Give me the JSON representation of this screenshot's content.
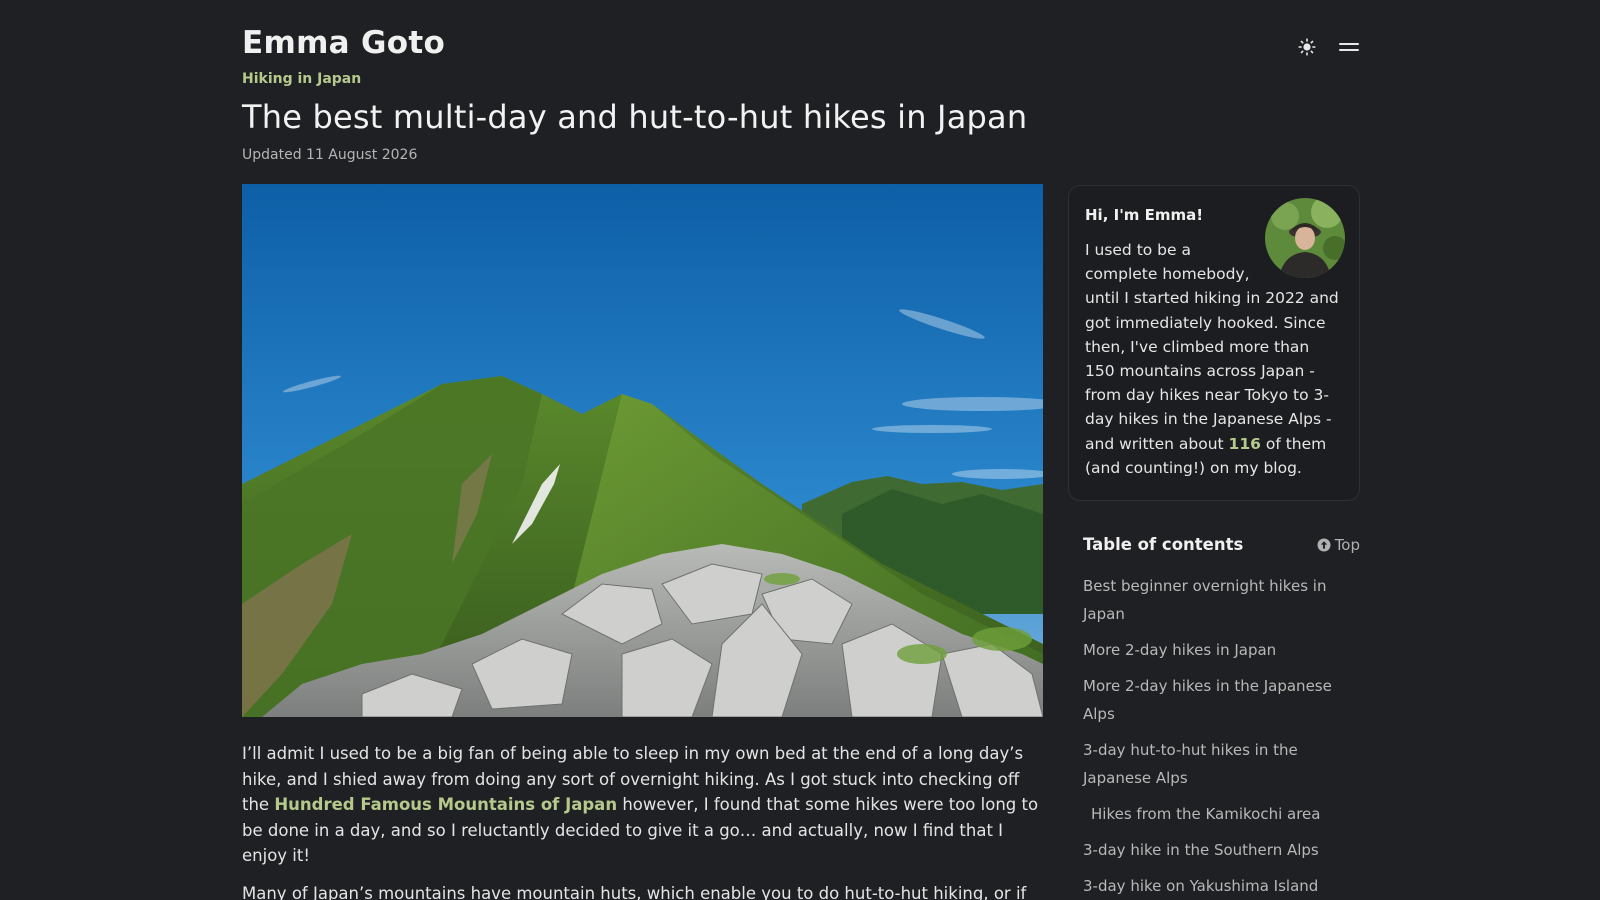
{
  "header": {
    "site_title": "Emma Goto",
    "category": "Hiking in Japan",
    "theme_icon": "sun-icon",
    "menu_icon": "menu-icon"
  },
  "post": {
    "title": "The best multi-day and hut-to-hut hikes in Japan",
    "updated": "Updated 11 August 2026"
  },
  "article": {
    "p1_before_link": "I’ll admit I used to be a big fan of being able to sleep in my own bed at the end of a long day’s hike, and I shied away from doing any sort of overnight hiking. As I got stuck into checking off the ",
    "p1_link": "Hundred Famous Mountains of Japan",
    "p1_after_link": " however, I found that some hikes were too long to be done in a day, and so I reluctantly decided to give it a go… and actually, now I find that I enjoy it!",
    "p2": "Many of Japan’s mountains have mountain huts, which enable you to do hut-to-hut hiking, or if"
  },
  "about": {
    "heading": "Hi, I'm Emma!",
    "text_before_count": "I used to be a complete homebody, until I started hiking in 2022 and got immediately hooked. Since then, I've climbed more than 150 mountains across Japan - from day hikes near Tokyo to 3-day hikes in the Japanese Alps - and written about ",
    "count": "116",
    "text_after_count": " of them (and counting!) on my blog."
  },
  "toc": {
    "title": "Table of contents",
    "top_label": "Top",
    "items": [
      {
        "label": "Best beginner overnight hikes in Japan",
        "sub": false
      },
      {
        "label": "More 2-day hikes in Japan",
        "sub": false
      },
      {
        "label": "More 2-day hikes in the Japanese Alps",
        "sub": false
      },
      {
        "label": "3-day hut-to-hut hikes in the Japanese Alps",
        "sub": false
      },
      {
        "label": "Hikes from the Kamikochi area",
        "sub": true
      },
      {
        "label": "3-day hike in the Southern Alps",
        "sub": false
      },
      {
        "label": "3-day hike on Yakushima Island",
        "sub": false
      }
    ]
  },
  "colors": {
    "background": "#1f2023",
    "accent": "#b6c98d",
    "text": "#e6e6e6"
  }
}
